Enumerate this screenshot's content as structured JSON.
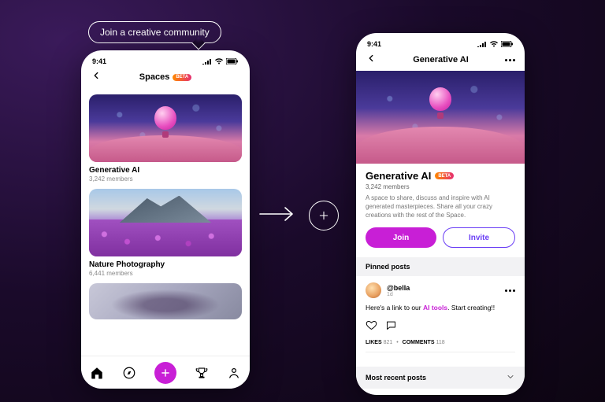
{
  "speech_bubble": "Join a creative community",
  "left": {
    "status_time": "9:41",
    "nav_title": "Spaces",
    "badge": "BETA",
    "cards": [
      {
        "title": "Generative AI",
        "members": "3,242 members"
      },
      {
        "title": "Nature Photography",
        "members": "6,441 members"
      },
      {
        "title": "",
        "members": ""
      }
    ]
  },
  "right": {
    "status_time": "9:41",
    "nav_title": "Generative AI",
    "title": "Generative AI",
    "badge": "BETA",
    "members": "3,242 members",
    "description": "A space to share, discuss and inspire with AI generated masterpieces. Share all your crazy creations with the rest of the Space.",
    "join_label": "Join",
    "invite_label": "Invite",
    "pinned_header": "Pinned posts",
    "recent_header": "Most recent posts",
    "post": {
      "user": "@bella",
      "time": "1d",
      "prefix": "Here's a link to our ",
      "highlight": "AI tools",
      "suffix": ". Start creating!!",
      "likes_label": "LIKES",
      "likes_count": "821",
      "comments_label": "COMMENTS",
      "comments_count": "118"
    }
  },
  "colors": {
    "accent": "#c81fd6",
    "accent2": "#6a3ef5"
  }
}
